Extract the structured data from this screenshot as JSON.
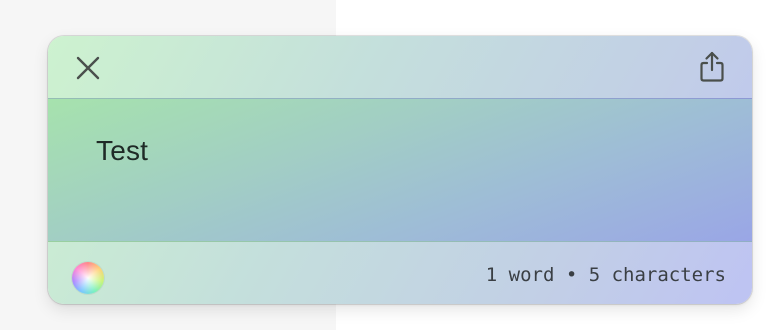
{
  "panel": {
    "close_icon": "close-icon",
    "share_icon": "share-icon",
    "text": "Test",
    "color_picker_icon": "color-wheel-icon",
    "stats": "1 word • 5 characters"
  },
  "colors": {
    "gradient_start": "#cdf2cf",
    "gradient_end": "#bec3f3",
    "text": "#1f2a26"
  }
}
